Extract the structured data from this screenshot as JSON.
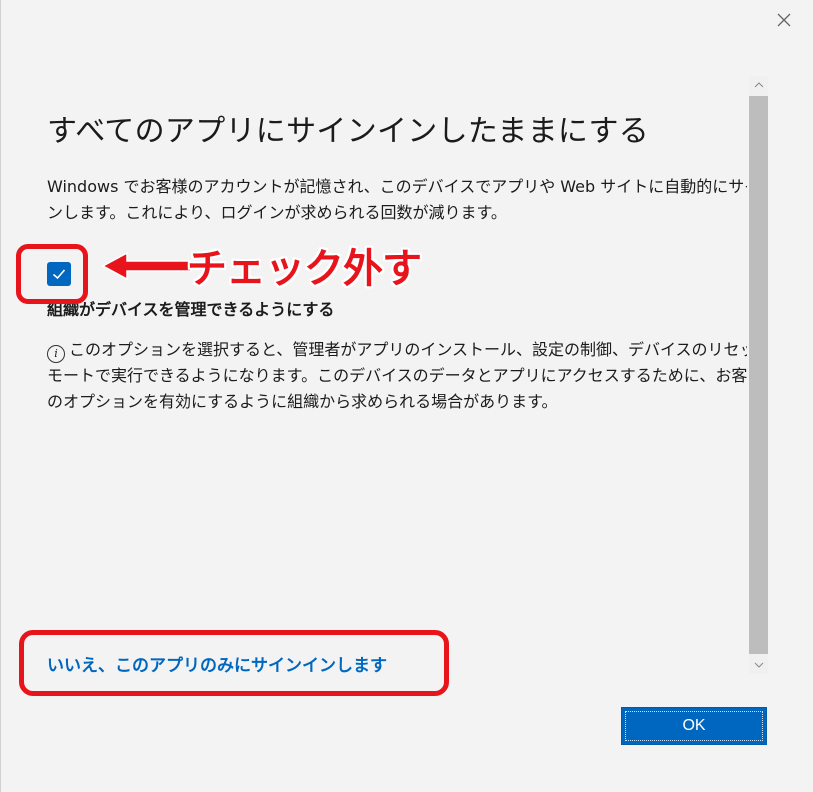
{
  "dialog": {
    "title": "すべてのアプリにサインインしたままにする",
    "description": "Windows でお客様のアカウントが記憶され、このデバイスでアプリや Web サイトに自動的にサインインします。これにより、ログインが求められる回数が減ります。",
    "checkbox": {
      "label": "組織がデバイスを管理できるようにする",
      "checked": true
    },
    "info_text": "このオプションを選択すると、管理者がアプリのインストール、設定の制御、デバイスのリセットをリモートで実行できるようになります。このデバイスのデータとアプリにアクセスするために、お客様がこのオプションを有効にするように組織から求められる場合があります。",
    "link_label": "いいえ、このアプリのみにサインインします",
    "ok_label": "OK"
  },
  "annotation": {
    "text": "チェック外す",
    "color": "#e8141c"
  },
  "colors": {
    "accent": "#0067c0",
    "background": "#f3f3f3"
  },
  "icons": {
    "close": "close-icon",
    "check": "checkmark-icon",
    "info": "info-icon",
    "scroll_up": "chevron-up-icon",
    "scroll_down": "chevron-down-icon"
  }
}
